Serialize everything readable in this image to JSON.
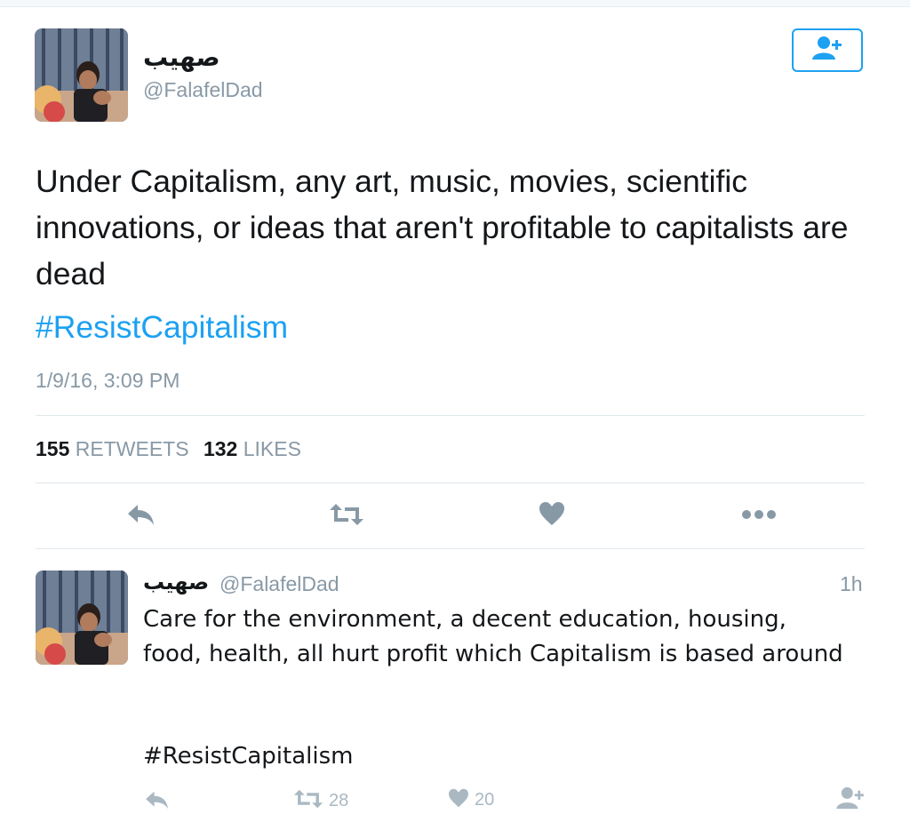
{
  "tweet": {
    "display_name": "صهيب",
    "handle": "@FalafelDad",
    "text": "Under Capitalism, any art, music, movies, scientific innovations, or ideas that aren't profitable to capitalists are dead",
    "hashtag": "#ResistCapitalism",
    "timestamp": "1/9/16, 3:09 PM",
    "retweets_count": "155",
    "retweets_label": "RETWEETS",
    "likes_count": "132",
    "likes_label": "LIKES"
  },
  "actions": {
    "icons": [
      "reply-icon",
      "retweet-icon",
      "heart-icon",
      "more-icon"
    ]
  },
  "reply": {
    "display_name": "صهيب",
    "handle": "@FalafelDad",
    "time": "1h",
    "text": "Care for the environment, a decent education, housing, food, health, all hurt profit which Capitalism is based around",
    "hashtag": "#ResistCapitalism",
    "retweets_count": "28",
    "likes_count": "20"
  },
  "colors": {
    "accent": "#1da1f2",
    "muted": "#8899a6",
    "icon_gray": "#aab8c2",
    "text": "#14171a"
  }
}
